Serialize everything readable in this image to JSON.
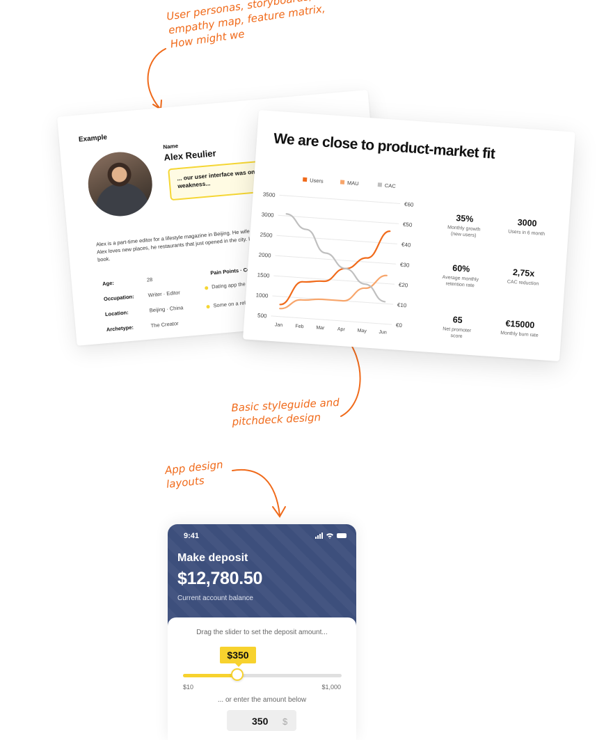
{
  "annotations": {
    "top": "User personas, storyboards,\nempathy map, feature matrix,\nHow might we",
    "middle": "Basic styleguide and\npitchdeck design",
    "bottom": "App design\nlayouts",
    "accent_color": "#f06a1a"
  },
  "persona": {
    "label": "Example",
    "name_label": "Name",
    "name": "Alex Reulier",
    "quote": "... our user interface was one of the major weakness...",
    "bio": "Alex is a part-time editor for a lifestyle magazine in Beijing. He wife and stayed after the divorce. Alex loves new places, he restaurants that just opened in the city. In his free time, he science fiction book.",
    "fields": [
      {
        "key": "Age:",
        "value": "28"
      },
      {
        "key": "Occupation:",
        "value": "Writer · Editor"
      },
      {
        "key": "Location:",
        "value": "Beijing · China"
      },
      {
        "key": "Archetype:",
        "value": "The Creator"
      }
    ],
    "pain_title": "Pain Points · Co",
    "pain_points": [
      "Dating app the right p",
      "Some on a relatio"
    ],
    "quote_color": "#f5d633"
  },
  "slide": {
    "title": "We are close to product-market fit",
    "kpis": [
      {
        "value": "35%",
        "label": "Monthly growth\n(new users)"
      },
      {
        "value": "3000",
        "label": "Users in 6 month"
      },
      {
        "value": "60%",
        "label": "Average monthly\nretention rate"
      },
      {
        "value": "2,75x",
        "label": "CAC reduction"
      },
      {
        "value": "65",
        "label": "Net promoter\nscore"
      },
      {
        "value": "€15000",
        "label": "Monthly burn rate"
      }
    ]
  },
  "chart_data": {
    "type": "line",
    "title": "We are close to product-market fit",
    "categories": [
      "Jan",
      "Feb",
      "Mar",
      "Apr",
      "May",
      "Jun"
    ],
    "y_left": {
      "ticks": [
        "3500",
        "3000",
        "2500",
        "2000",
        "1500",
        "1000",
        "500"
      ],
      "range": [
        500,
        3500
      ]
    },
    "y_right": {
      "ticks": [
        "€60",
        "€50",
        "€40",
        "€30",
        "€20",
        "€10",
        "€0"
      ],
      "range": [
        0,
        60
      ]
    },
    "legend_position": "top",
    "grid": true,
    "series": [
      {
        "name": "Users",
        "axis": "left",
        "color": "#f06a1a",
        "values": [
          800,
          1400,
          1450,
          1800,
          2100,
          2800
        ]
      },
      {
        "name": "MAU",
        "axis": "left",
        "color": "#f7a56b",
        "values": [
          700,
          950,
          1000,
          1000,
          1350,
          1700
        ]
      },
      {
        "name": "CAC",
        "axis": "left",
        "color": "#bfbfbf",
        "values": [
          3050,
          2700,
          2150,
          1800,
          1450,
          1050
        ]
      }
    ]
  },
  "phone": {
    "time": "9:41",
    "title": "Make deposit",
    "balance": "$12,780.50",
    "balance_label": "Current account balance",
    "hint": "Drag the slider to set the deposit amount...",
    "selected": "$350",
    "slider_min": "$10",
    "slider_max": "$1,000",
    "slider_value": 350,
    "slider_range": [
      10,
      1000
    ],
    "or_text": "... or enter the amount below",
    "amount_value": "350",
    "currency_symbol": "$",
    "header_color": "#3d4f7c",
    "accent_color": "#f7d22e"
  }
}
